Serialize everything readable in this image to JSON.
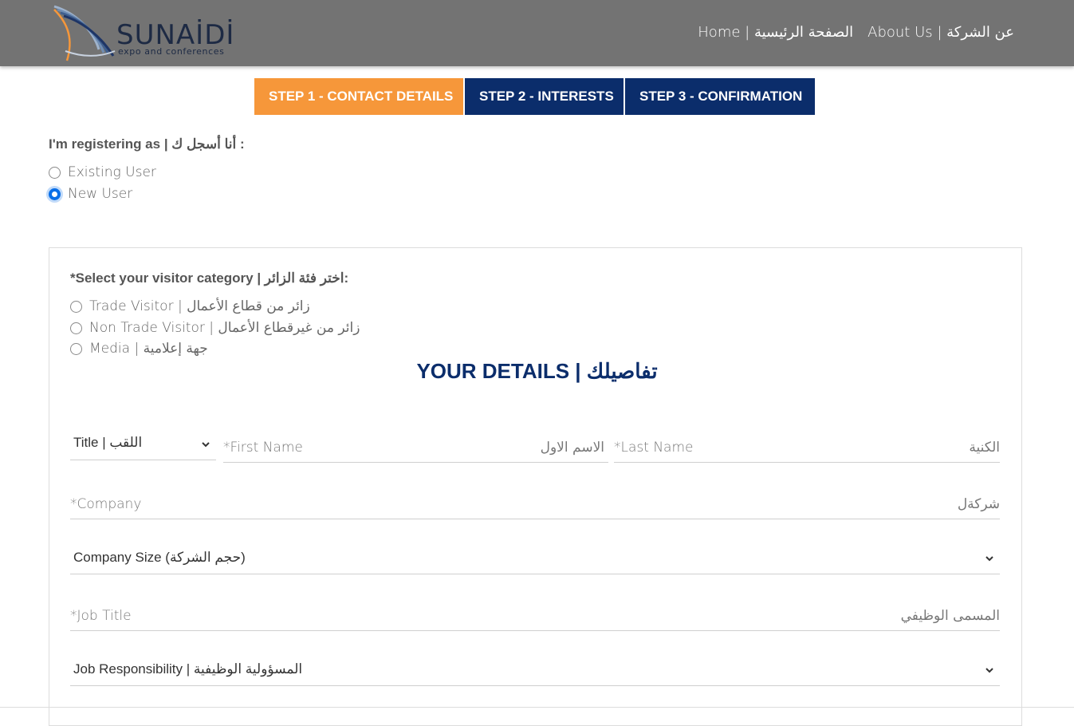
{
  "header": {
    "logo_name": "SUNAİDİ",
    "logo_sub": "expo and conferences",
    "nav": [
      {
        "label": "Home | الصفحة الرئيسية"
      },
      {
        "label": "About Us | عن الشركة"
      }
    ]
  },
  "steps": [
    {
      "label": "STEP 1 - CONTACT DETAILS",
      "active": true
    },
    {
      "label": "STEP 2 - INTERESTS",
      "active": false
    },
    {
      "label": "STEP 3 - CONFIRMATION",
      "active": false
    }
  ],
  "registering": {
    "label": "I'm registering as | أنا أسجل ك :",
    "options": [
      {
        "label": "Existing User",
        "checked": false
      },
      {
        "label": "New User",
        "checked": true
      }
    ]
  },
  "category": {
    "label": "*Select your visitor category | اختر فئة الزائر:",
    "options": [
      {
        "label": "Trade Visitor | زائر من قطاع الأعمال",
        "checked": false
      },
      {
        "label": "Non Trade Visitor | زائر من غيرقطاع الأعمال",
        "checked": false
      },
      {
        "label": "Media | جهة إعلامية",
        "checked": false
      }
    ]
  },
  "details": {
    "title": "YOUR DETAILS | تفاصيلك",
    "title_select": "Title | اللقب",
    "first_name": {
      "en": "*First Name",
      "ar": "الاسم الاول"
    },
    "last_name": {
      "en": "*Last Name",
      "ar": "الكنية"
    },
    "company": {
      "en": "*Company",
      "ar": "شركةل"
    },
    "company_size": "Company Size (حجم الشركة)",
    "job_title": {
      "en": "*Job Title",
      "ar": "المسمى الوظيفي"
    },
    "job_responsibility": "Job Responsibility | المسؤولية الوظيفية"
  },
  "colors": {
    "header_bg": "#737373",
    "step_active": "#f6973a",
    "step_inactive": "#0b2d6b",
    "accent": "#0a6fe8"
  }
}
